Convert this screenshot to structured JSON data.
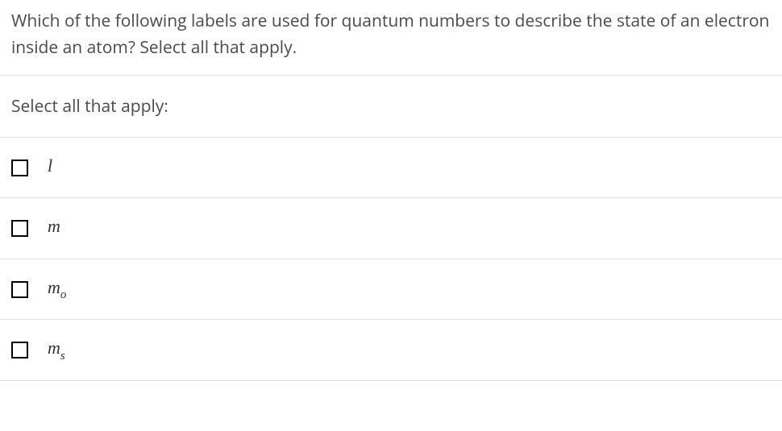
{
  "question": {
    "text": "Which of the following labels are used for quantum numbers to describe the state of an electron inside an atom? Select all that apply."
  },
  "prompt": {
    "text": "Select all that apply:"
  },
  "options": [
    {
      "main": "l",
      "sub": ""
    },
    {
      "main": "m",
      "sub": ""
    },
    {
      "main": "m",
      "sub": "o"
    },
    {
      "main": "m",
      "sub": "s"
    }
  ]
}
